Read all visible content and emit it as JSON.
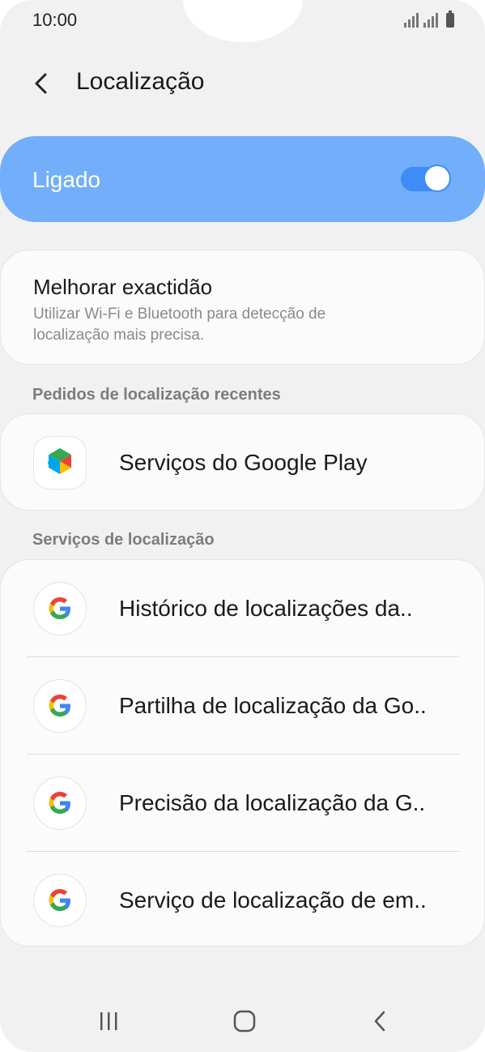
{
  "status_bar": {
    "time": "10:00"
  },
  "header": {
    "title": "Localização"
  },
  "master_toggle": {
    "label": "Ligado",
    "on": true
  },
  "improve_accuracy": {
    "title": "Melhorar exactidão",
    "description": "Utilizar Wi-Fi e Bluetooth para detecção de localização mais precisa."
  },
  "recent_requests": {
    "header": "Pedidos de localização recentes",
    "items": [
      {
        "label": "Serviços do Google Play",
        "icon": "google-play-services-icon"
      }
    ]
  },
  "location_services": {
    "header": "Serviços de localização",
    "items": [
      {
        "label": "Histórico de localizações da..",
        "icon": "google-icon"
      },
      {
        "label": "Partilha de localização da Go..",
        "icon": "google-icon"
      },
      {
        "label": "Precisão da localização da G..",
        "icon": "google-icon"
      },
      {
        "label": "Serviço de localização de em..",
        "icon": "google-icon"
      }
    ]
  },
  "colors": {
    "toggle_bg": "#73aefb",
    "switch_track": "#3e8cf5",
    "background": "#f1f1f1"
  }
}
